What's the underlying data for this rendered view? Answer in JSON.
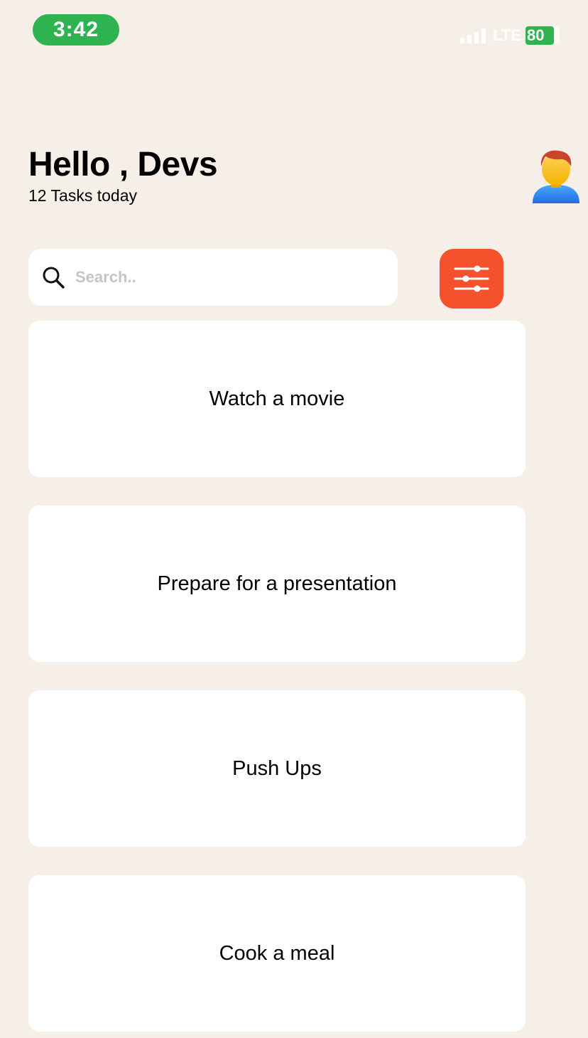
{
  "status_bar": {
    "time": "3:42",
    "network": "LTE",
    "battery": "80"
  },
  "header": {
    "greeting": "Hello , Devs",
    "subtitle": "12 Tasks today",
    "avatar_icon": "person-avatar-icon"
  },
  "search": {
    "placeholder": "Search..",
    "value": "",
    "icon": "search-icon"
  },
  "filter_button": {
    "icon": "sliders-icon",
    "color": "#f4512c"
  },
  "tasks": [
    {
      "title": "Watch a movie"
    },
    {
      "title": "Prepare for a presentation"
    },
    {
      "title": "Push Ups"
    },
    {
      "title": "Cook a meal"
    }
  ],
  "colors": {
    "background": "#f6efe8",
    "accent": "#f4512c",
    "status_green": "#2fb350"
  }
}
